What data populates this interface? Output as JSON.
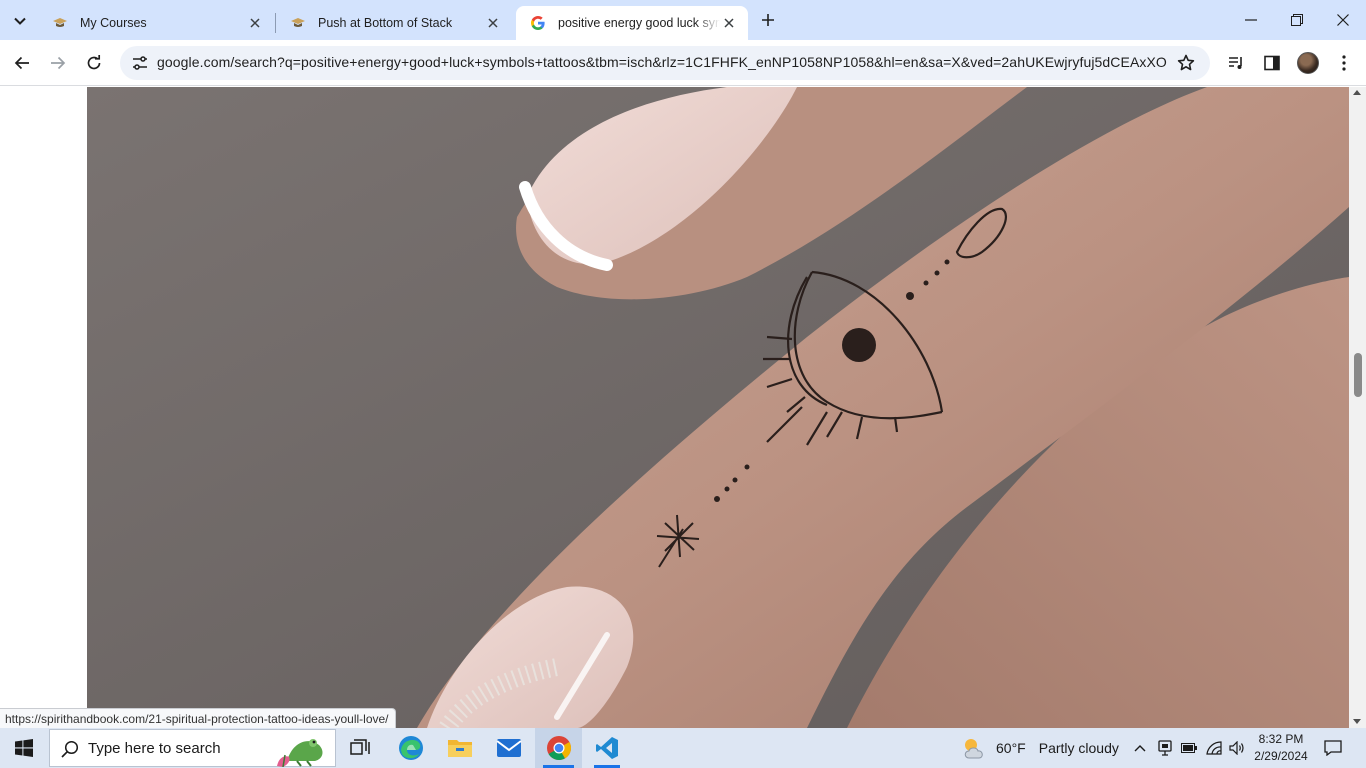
{
  "tabs": [
    {
      "title": "My Courses",
      "favicon": "course-hat-icon",
      "active": false
    },
    {
      "title": "Push at Bottom of Stack",
      "favicon": "course-hat-icon",
      "active": false
    },
    {
      "title": "positive energy good luck symbols tattoos",
      "favicon": "google-g-icon",
      "active": true
    }
  ],
  "address_bar": {
    "url": "google.com/search?q=positive+energy+good+luck+symbols+tattoos&tbm=isch&rlz=1C1FHFK_enNP1058NP1058&hl=en&sa=X&ved=2ahUKEwjryfuj5dCEAxXO..."
  },
  "status_bar": {
    "hover_url": "https://spirithandbook.com/21-spiritual-protection-tattoo-ideas-youll-love/"
  },
  "taskbar": {
    "search_placeholder": "Type here to search",
    "weather_temp": "60°F",
    "weather_condition": "Partly cloudy",
    "time": "8:32 PM",
    "date": "2/29/2024"
  },
  "colors": {
    "tabstrip_bg": "#d3e3fd",
    "omnibox_bg": "#eef2f9",
    "taskbar_bg": "#dde6f3",
    "accent": "#1a73e8"
  },
  "icons": [
    "tab-search-icon",
    "close-icon",
    "new-tab-icon",
    "minimize-icon",
    "restore-icon",
    "back-icon",
    "forward-icon",
    "reload-icon",
    "site-info-icon",
    "bookmark-star-icon",
    "media-control-icon",
    "side-panel-icon",
    "profile-avatar",
    "windows-start-icon",
    "search-icon",
    "task-view-icon",
    "edge-icon",
    "file-explorer-icon",
    "mail-icon",
    "chrome-icon",
    "vscode-icon",
    "weather-icon",
    "chevron-up-icon",
    "meet-now-icon",
    "battery-icon",
    "wifi-icon",
    "volume-icon",
    "notification-icon"
  ]
}
